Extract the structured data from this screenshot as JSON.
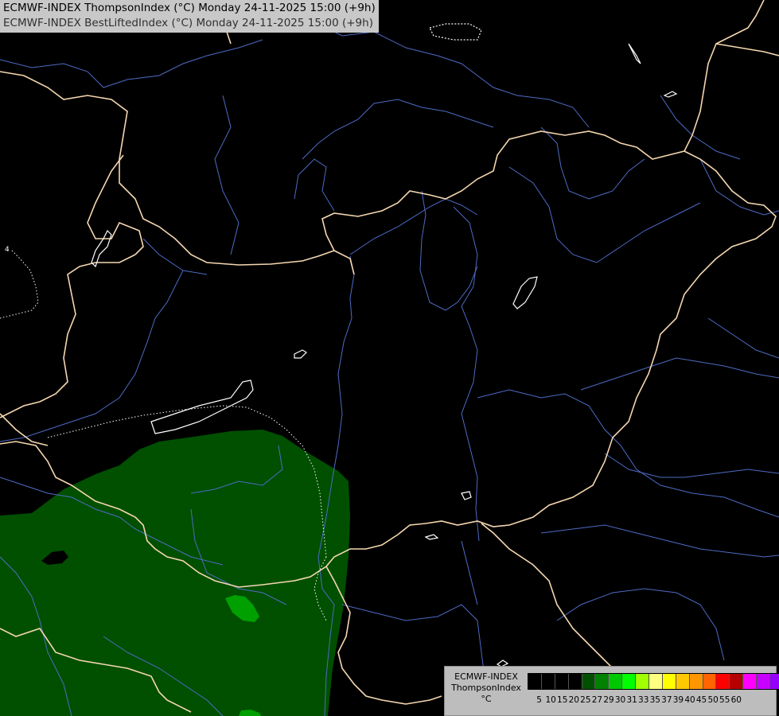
{
  "title": {
    "line1": "ECMWF-INDEX ThompsonIndex (°C) Monday 24-11-2025 15:00 (+9h)",
    "line2": "ECMWF-INDEX BestLiftedIndex (°C) Monday 24-11-2025 15:00 (+9h)"
  },
  "map": {
    "background_color": "#000000",
    "border_color": "#f5d7b0",
    "river_color": "#4d6bc4",
    "lake_outline_color": "#ffffff",
    "contour_label": "4",
    "shaded_regions": [
      {
        "name": "thompson-index-20-25",
        "color": "#005000"
      },
      {
        "name": "thompson-index-25-27",
        "color": "#00a000"
      }
    ]
  },
  "legend": {
    "label_lines": [
      "ECMWF-INDEX",
      "ThompsonIndex",
      "°C"
    ],
    "colors": [
      "#000000",
      "#000000",
      "#000000",
      "#000000",
      "#005000",
      "#008200",
      "#00c800",
      "#00ff00",
      "#a0ff00",
      "#ffff80",
      "#ffff00",
      "#ffc800",
      "#ff9600",
      "#ff6400",
      "#ff0000",
      "#b40000",
      "#ff00ff",
      "#c800ff",
      "#9600ff",
      "#6400ff",
      "#0000ff"
    ],
    "ticks": [
      "5",
      "10",
      "15",
      "20",
      "25",
      "27",
      "29",
      "30",
      "31",
      "33",
      "35",
      "37",
      "39",
      "40",
      "45",
      "50",
      "55",
      "60"
    ]
  }
}
